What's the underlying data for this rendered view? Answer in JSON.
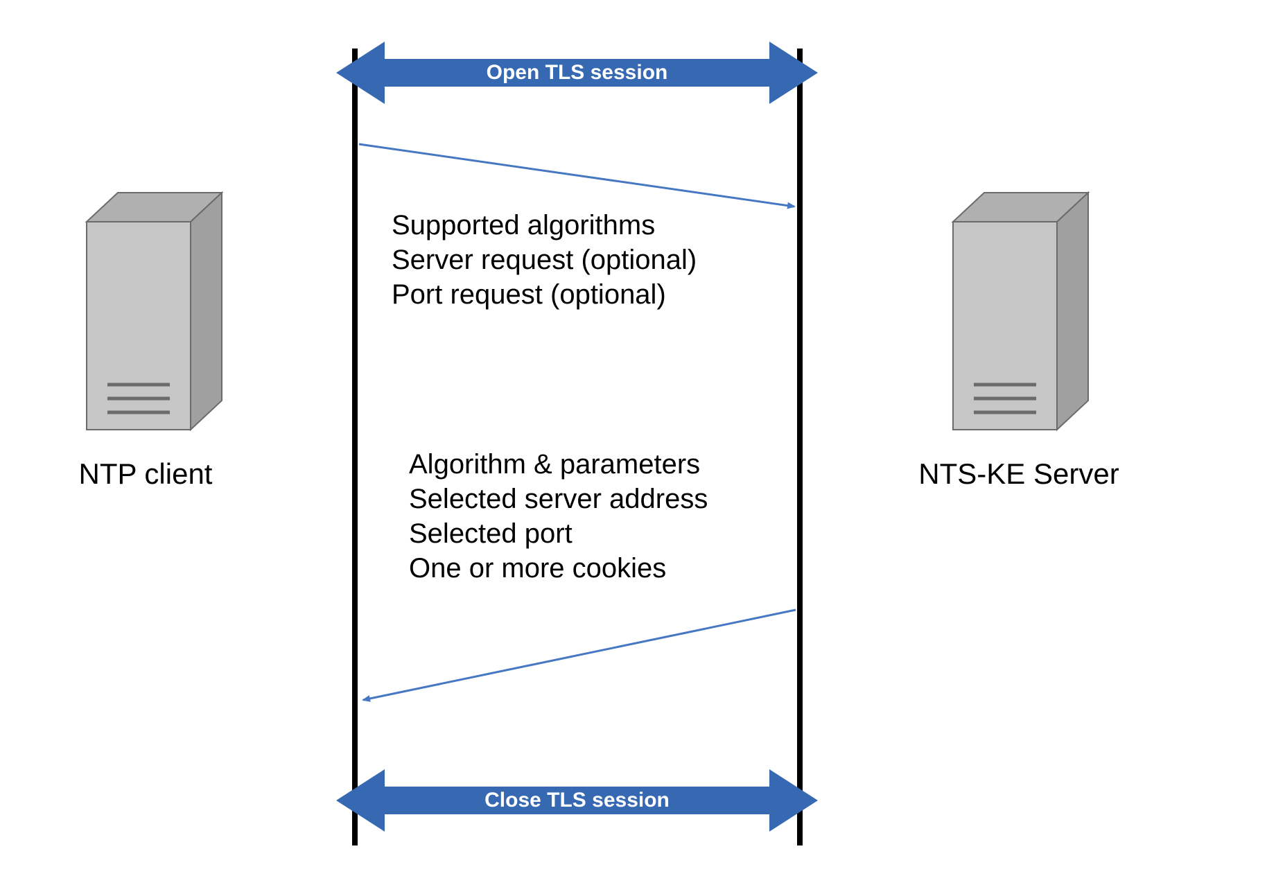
{
  "colors": {
    "banner": "#3669B1",
    "lifeline": "#000000",
    "arrow": "#4577C2",
    "server_body": "#C6C6C6",
    "server_top": "#B0B0B0",
    "server_side": "#A0A0A0",
    "server_detail": "#6B6B6B"
  },
  "nodes": {
    "left": {
      "label": "NTP client"
    },
    "right": {
      "label": "NTS-KE Server"
    }
  },
  "banners": {
    "top": "Open TLS session",
    "bottom": "Close TLS session"
  },
  "messages": {
    "client_to_server": [
      "Supported algorithms",
      "Server request (optional)",
      "Port request (optional)"
    ],
    "server_to_client": [
      "Algorithm & parameters",
      "Selected server address",
      "Selected port",
      "One or more cookies"
    ]
  }
}
